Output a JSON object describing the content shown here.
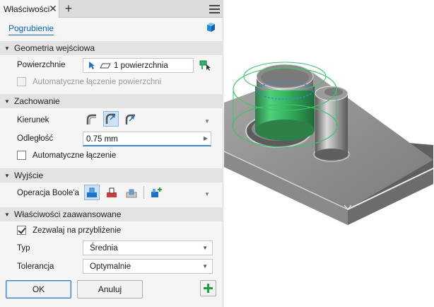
{
  "tab": {
    "label": "Właściwości",
    "close_icon": "close-icon",
    "add_icon": "plus-icon",
    "menu_icon": "hamburger-menu-icon"
  },
  "feature": {
    "title": "Pogrubienie",
    "icon": "thicken-cube-icon"
  },
  "sections": {
    "input_geometry": "Geometria wejściowa",
    "behavior": "Zachowanie",
    "output": "Wyjście",
    "advanced": "Właściwości zaawansowane"
  },
  "input_geometry": {
    "surfaces_label": "Powierzchnie",
    "surfaces_value": "1 powierzchnia",
    "auto_chain_label": "Automatyczne łączenie powierzchni",
    "auto_chain_checked": false,
    "auto_chain_enabled": false
  },
  "behavior": {
    "direction_label": "Kierunek",
    "direction_selected": 1,
    "distance_label": "Odległość",
    "distance_value": "0.75 mm",
    "auto_blend_label": "Automatyczne łączenie",
    "auto_blend_checked": false
  },
  "output": {
    "boolean_label": "Operacja Boole'a",
    "boolean_selected": 0
  },
  "advanced": {
    "approx_label": "Zezwalaj na przybliżenie",
    "approx_checked": true,
    "type_label": "Typ",
    "type_value": "Średnia",
    "tolerance_label": "Tolerancja",
    "tolerance_value": "Optymalnie"
  },
  "buttons": {
    "ok": "OK",
    "cancel": "Anuluj",
    "apply_icon": "plus-icon"
  },
  "colors": {
    "accent": "#0a64b6",
    "selection_green": "#3cc36a",
    "apply_green": "#1e9e3a"
  }
}
